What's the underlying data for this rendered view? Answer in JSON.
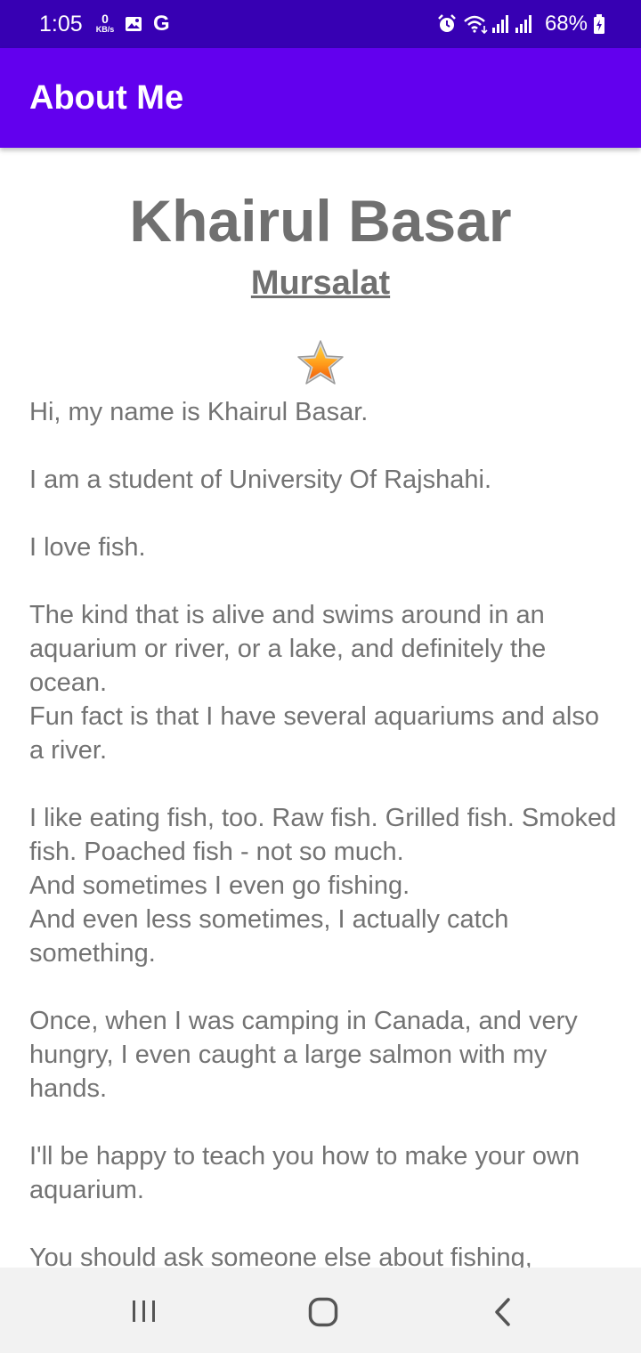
{
  "status_bar": {
    "time": "1:05",
    "net_speed_value": "0",
    "net_speed_unit": "KB/s",
    "google_glyph": "G",
    "battery_percent": "68%",
    "icons": [
      "gallery-icon",
      "google-icon",
      "alarm-icon",
      "wifi-icon",
      "signal-icon",
      "signal-icon",
      "battery-icon"
    ],
    "background": "#3700b3"
  },
  "app_bar": {
    "title": "About Me",
    "background": "#6200ee"
  },
  "profile": {
    "name": "Khairul Basar",
    "nickname": "Mursalat",
    "star_icon": "star-icon",
    "bio": "Hi, my name is Khairul Basar.\n\nI am a student of University Of Rajshahi.\n\nI love fish.\n\nThe kind that is alive and swims around in an aquarium or river, or a lake, and definitely the ocean.\nFun fact is that I have several aquariums and also a river.\n\nI like eating fish, too. Raw fish. Grilled fish. Smoked fish. Poached fish - not so much.\nAnd sometimes I even go fishing.\nAnd even less sometimes, I actually catch something.\n\nOnce, when I was camping in Canada, and very hungry, I even caught a large salmon with my hands.\n\nI'll be happy to teach you how to make your own aquarium.\n\nYou should ask someone else about fishing, though."
  },
  "nav_bar": {
    "icons": [
      "recents-icon",
      "home-icon",
      "back-icon"
    ],
    "background": "#f2f2f2"
  }
}
